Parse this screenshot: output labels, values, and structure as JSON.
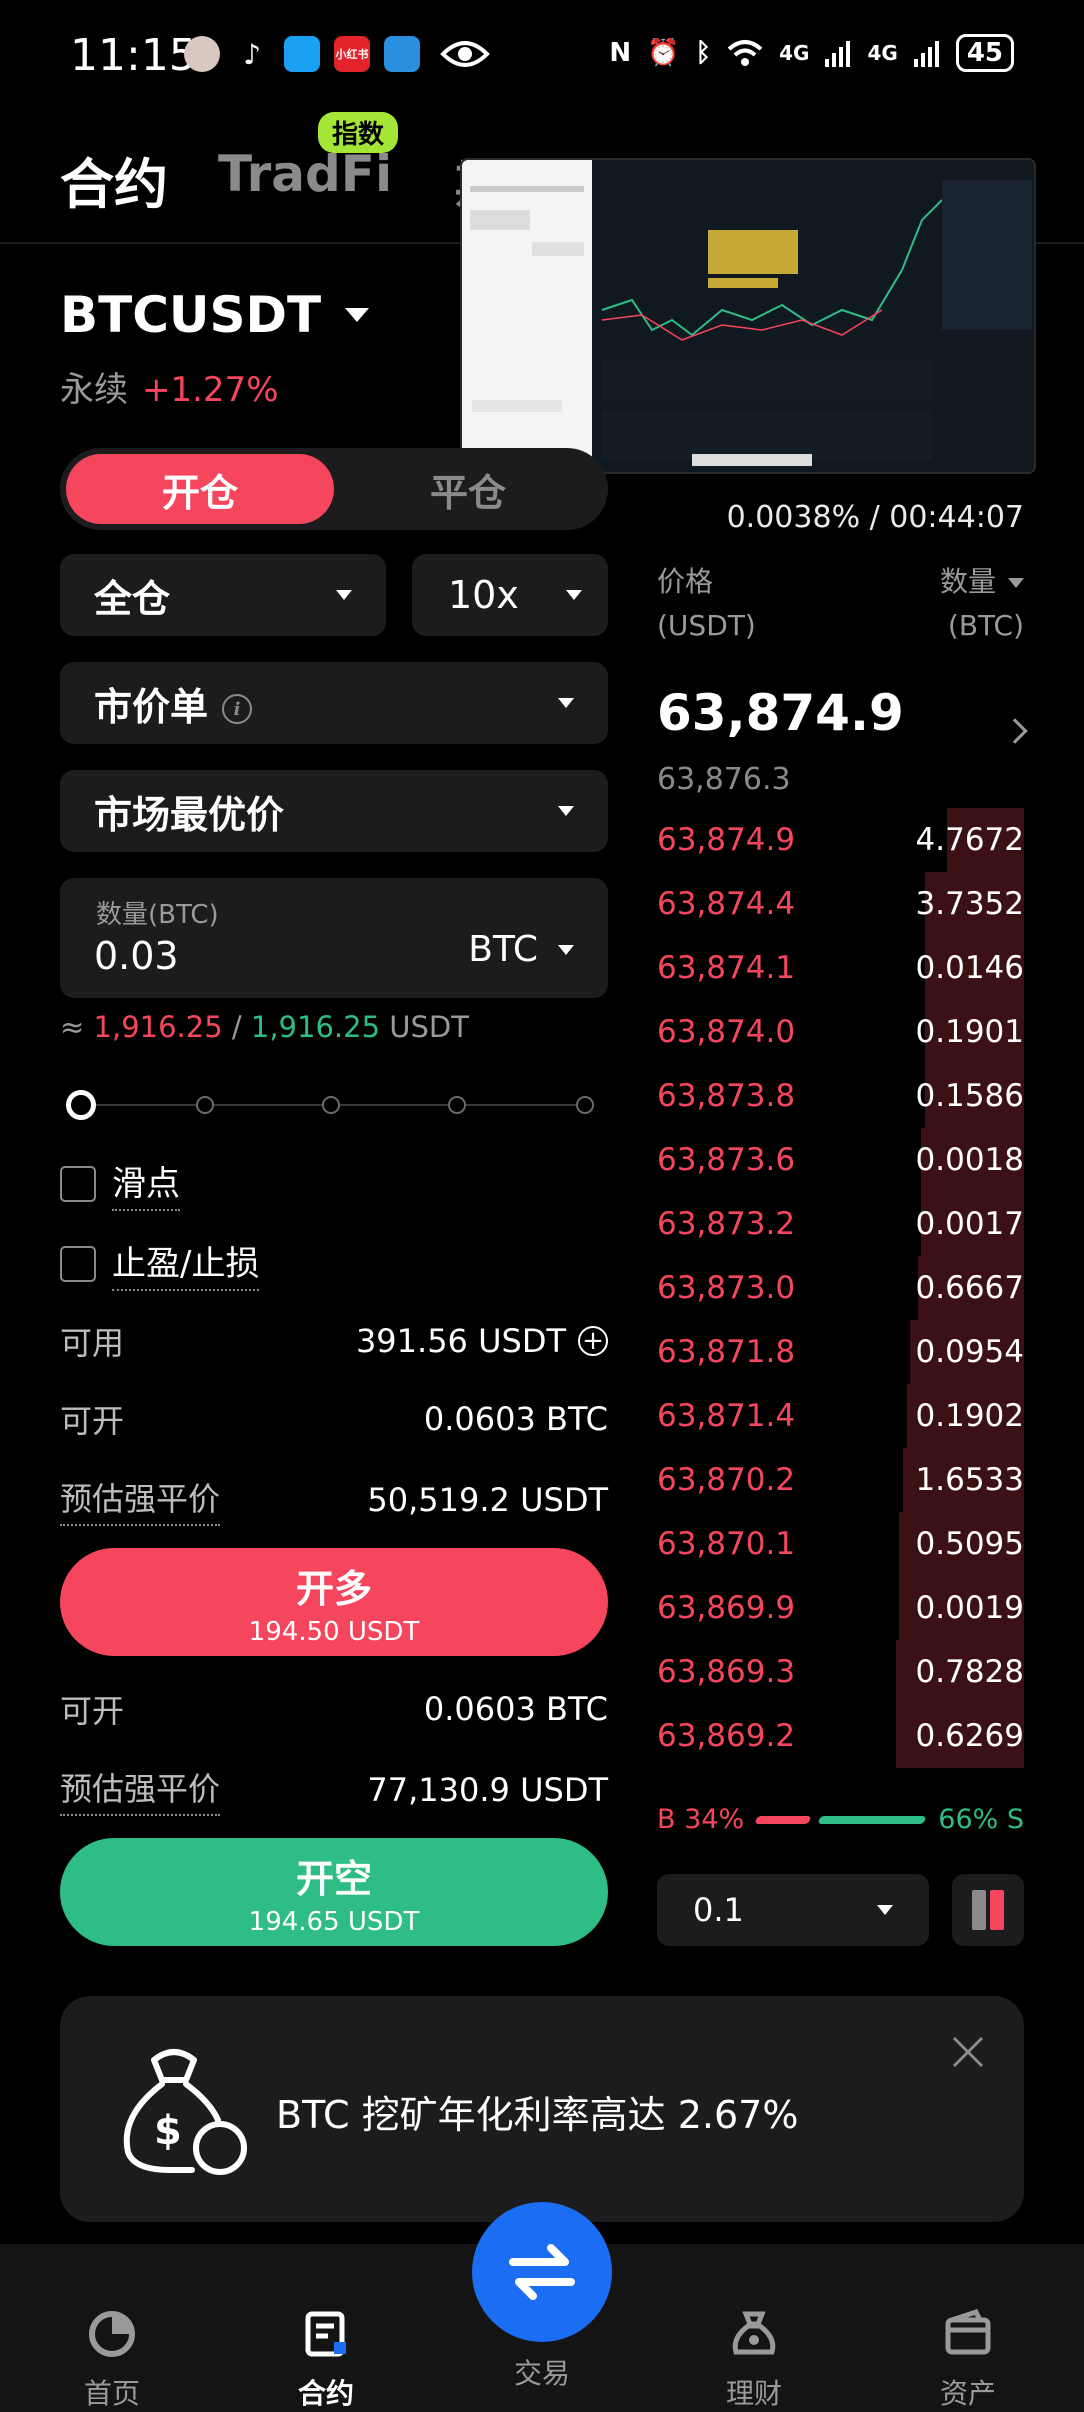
{
  "status_bar": {
    "time": "11:15",
    "battery": "45",
    "net1": "4G",
    "net2": "4G",
    "app_tiktok": "♪",
    "app_xhs": "小红书"
  },
  "header": {
    "tab_contract": "合约",
    "tab_tradfi": "TradFi",
    "tab_badge": "指数",
    "tab_third": "期权"
  },
  "symbol": {
    "name": "BTCUSDT",
    "kind": "永续",
    "change": "+1.27%"
  },
  "funding": {
    "text": "0.0038% / 00:44:07"
  },
  "order_form": {
    "open_label": "开仓",
    "close_label": "平仓",
    "margin_mode": "全仓",
    "leverage": "10x",
    "order_type": "市价单",
    "price_type": "市场最优价",
    "qty_label": "数量(BTC)",
    "qty_value": "0.03",
    "qty_unit": "BTC",
    "approx_prefix": "≈",
    "approx_red": "1,916.25",
    "approx_sep": "/",
    "approx_green": "1,916.25",
    "approx_unit": "USDT",
    "slider_fraction": 0,
    "slippage": "滑点",
    "tpsl": "止盈/止损",
    "available_label": "可用",
    "available_value": "391.56 USDT",
    "long_max_label": "可开",
    "long_max_value": "0.0603 BTC",
    "long_liq_label": "预估强平价",
    "long_liq_value": "50,519.2 USDT",
    "long_btn": "开多",
    "long_cost": "194.50 USDT",
    "short_max_label": "可开",
    "short_max_value": "0.0603 BTC",
    "short_liq_label": "预估强平价",
    "short_liq_value": "77,130.9 USDT",
    "short_btn": "开空",
    "short_cost": "194.65 USDT"
  },
  "orderbook": {
    "price_header": "价格",
    "price_unit": "(USDT)",
    "qty_header": "数量",
    "qty_unit": "(BTC)",
    "last_price": "63,874.9",
    "mark_price": "63,876.3",
    "rows": [
      {
        "price": "63,874.9",
        "qty": "4.7672",
        "depth": 0.21
      },
      {
        "price": "63,874.4",
        "qty": "3.7352",
        "depth": 0.27
      },
      {
        "price": "63,874.1",
        "qty": "0.0146",
        "depth": 0.27
      },
      {
        "price": "63,874.0",
        "qty": "0.1901",
        "depth": 0.27
      },
      {
        "price": "63,873.8",
        "qty": "0.1586",
        "depth": 0.27
      },
      {
        "price": "63,873.6",
        "qty": "0.0018",
        "depth": 0.28
      },
      {
        "price": "63,873.2",
        "qty": "0.0017",
        "depth": 0.28
      },
      {
        "price": "63,873.0",
        "qty": "0.6667",
        "depth": 0.29
      },
      {
        "price": "63,871.8",
        "qty": "0.0954",
        "depth": 0.31
      },
      {
        "price": "63,871.4",
        "qty": "0.1902",
        "depth": 0.32
      },
      {
        "price": "63,870.2",
        "qty": "1.6533",
        "depth": 0.33
      },
      {
        "price": "63,870.1",
        "qty": "0.5095",
        "depth": 0.34
      },
      {
        "price": "63,869.9",
        "qty": "0.0019",
        "depth": 0.34
      },
      {
        "price": "63,869.3",
        "qty": "0.7828",
        "depth": 0.35
      },
      {
        "price": "63,869.2",
        "qty": "0.6269",
        "depth": 0.35
      }
    ],
    "buy_ratio": "B 34%",
    "sell_ratio": "66% S",
    "buy_pct": 34,
    "sell_pct": 66,
    "tick_size": "0.1"
  },
  "promo": {
    "text": "BTC 挖矿年化利率高达 2.67%"
  },
  "nav": {
    "home": "首页",
    "contract": "合约",
    "trade": "交易",
    "finance": "理财",
    "assets": "资产"
  },
  "colors": {
    "red": "#f6465d",
    "green": "#2ebd85",
    "accent": "#1b6ef3",
    "badge": "#a3e635"
  }
}
